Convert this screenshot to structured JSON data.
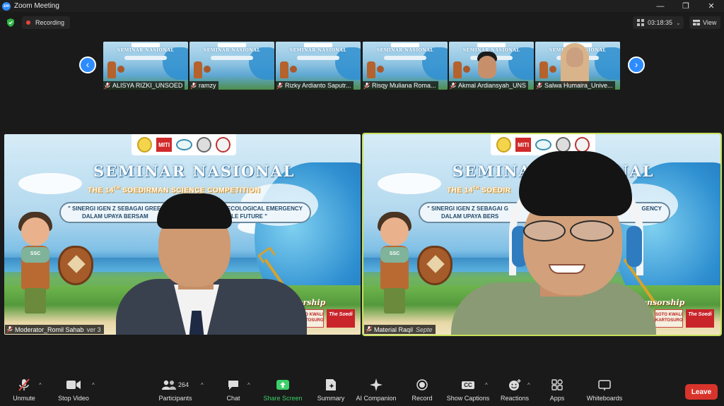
{
  "window": {
    "app_logo_text": "zm",
    "title": "Zoom Meeting",
    "minimize": "—",
    "maximize": "❐",
    "close": "✕"
  },
  "topbar": {
    "recording_label": "Recording",
    "timer": "03:18:35",
    "timer_caret": "⌄",
    "view_label": "View",
    "colors": {
      "shield": "#2fb344",
      "recording_dot": "#e8453c"
    }
  },
  "thumbnails": {
    "prev_arrow": "‹",
    "next_arrow": "›",
    "slide_title": "SEMINAR NASIONAL",
    "items": [
      {
        "name": "ALISYA RIZKI_UNSOED"
      },
      {
        "name": "ramzy"
      },
      {
        "name": "Rizky Ardianto Saputr..."
      },
      {
        "name": "Risqy Muliana Roma..."
      },
      {
        "name": "Akmal Ardiansyah_UNS"
      },
      {
        "name": "Salwa Humaira_Unive..."
      }
    ]
  },
  "slide": {
    "logo_text": "MITI",
    "title": "SEMINAR NASIONAL",
    "subtitle_left": "THE 14",
    "subtitle_sup": "TH",
    "subtitle_right_full": " SOEDIRMAN SCIENCE COMPETITION",
    "subtitle_right_cut": " SOEDIR",
    "band_line1_left": "\" SINERGI IGEN Z SEBAGAI GREE",
    "band_line1_right": "ECOLOGICAL EMERGENCY",
    "band_line2_left": "DALAM UPAYA BERSAM",
    "band_line2_right": "INABLE FUTURE \"",
    "band2_line1_left": "\" SINERGI IGEN Z SEBAGAI G",
    "band2_line1_right": "GENCY",
    "band2_line2_left": "DALAM UPAYA BERS",
    "band2_line2_right": "",
    "sponsor": "Sponsorship",
    "sponsor1": "SOTO KWALI KARTOSURO",
    "sponsor2": "The Soedi",
    "mascot_badge": "SSC"
  },
  "tiles": [
    {
      "label": "Moderator_Romil Sahab",
      "label_suffix": "ver 3",
      "active": false
    },
    {
      "label": "Material Raqil",
      "label_suffix": "Septe",
      "active": true
    }
  ],
  "toolbar": {
    "unmute": "Unmute",
    "stop_video": "Stop Video",
    "participants": "Participants",
    "participants_count": "264",
    "chat": "Chat",
    "share_screen": "Share Screen",
    "summary": "Summary",
    "ai_companion": "AI Companion",
    "record": "Record",
    "show_captions": "Show Captions",
    "captions_icon_text": "CC",
    "reactions": "Reactions",
    "apps": "Apps",
    "whiteboards": "Whiteboards",
    "leave": "Leave",
    "caret": "^",
    "colors": {
      "share": "#3ccf6a",
      "leave": "#d8342c",
      "mute_slash": "#e0483e"
    }
  }
}
